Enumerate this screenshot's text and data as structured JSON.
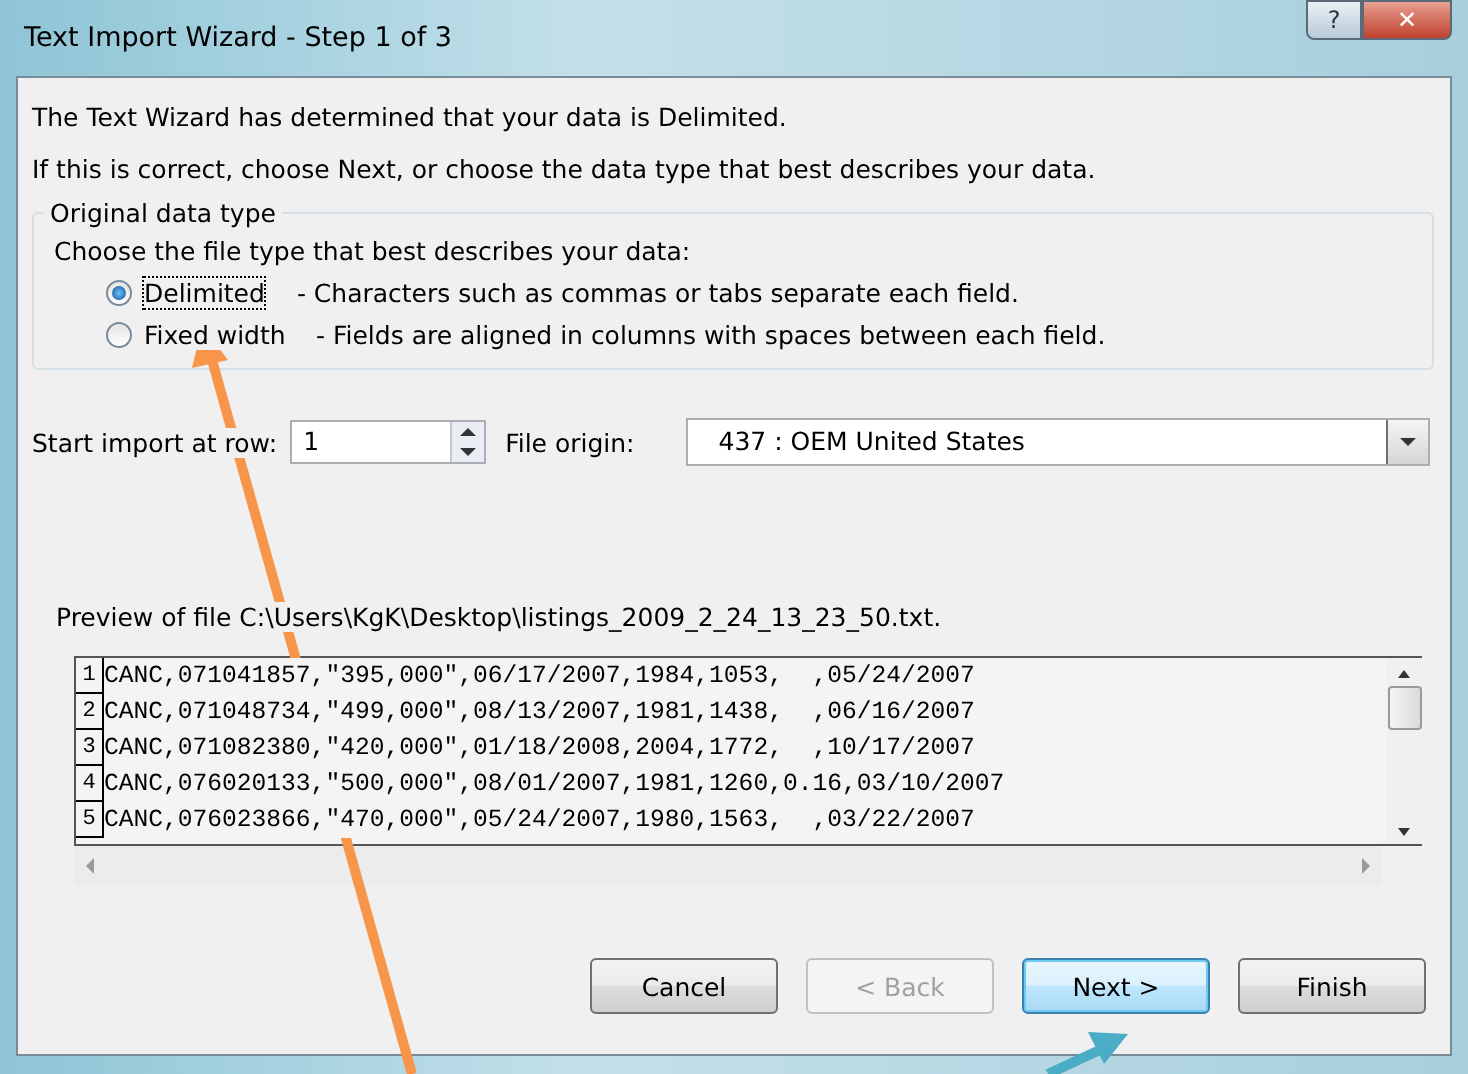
{
  "window": {
    "title": "Text Import Wizard - Step 1 of 3",
    "help_button": "?",
    "close_button": "✕"
  },
  "intro": [
    "The Text Wizard has determined that your data is Delimited.",
    "If this is correct, choose Next, or choose the data type that best describes your data."
  ],
  "data_type": {
    "legend": "Original data type",
    "prompt": "Choose the file type that best describes your data:",
    "options": [
      {
        "label": "Delimited",
        "description": "- Characters such as commas or tabs separate each field.",
        "selected": true
      },
      {
        "label": "Fixed width",
        "description": "- Fields are aligned in columns with spaces between each field.",
        "selected": false
      }
    ]
  },
  "start_row": {
    "label": "Start import at row:",
    "value": "1"
  },
  "file_origin": {
    "label": "File origin:",
    "value": "437 : OEM United States"
  },
  "preview": {
    "label": "Preview of file C:\\Users\\KgK\\Desktop\\listings_2009_2_24_13_23_50.txt.",
    "rows": [
      {
        "number": "1",
        "text": "CANC,071041857,\"395,000\",06/17/2007,1984,1053,  ,05/24/2007"
      },
      {
        "number": "2",
        "text": "CANC,071048734,\"499,000\",08/13/2007,1981,1438,  ,06/16/2007"
      },
      {
        "number": "3",
        "text": "CANC,071082380,\"420,000\",01/18/2008,2004,1772,  ,10/17/2007"
      },
      {
        "number": "4",
        "text": "CANC,076020133,\"500,000\",08/01/2007,1981,1260,0.16,03/10/2007"
      },
      {
        "number": "5",
        "text": "CANC,076023866,\"470,000\",05/24/2007,1980,1563,  ,03/22/2007"
      }
    ]
  },
  "buttons": [
    {
      "label": "Cancel",
      "disabled": false,
      "default": false
    },
    {
      "label": "< Back",
      "disabled": true,
      "default": false
    },
    {
      "label": "Next >",
      "disabled": false,
      "default": true
    },
    {
      "label": "Finish",
      "disabled": false,
      "default": false
    }
  ]
}
